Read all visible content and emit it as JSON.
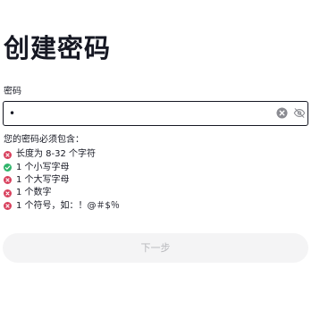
{
  "title": "创建密码",
  "password_field": {
    "label": "密码",
    "value": "•",
    "clear_icon": "clear-circle-x-icon",
    "toggle_icon": "eye-slash-icon"
  },
  "requirements": {
    "heading": "您的密码必须包含：",
    "items": [
      {
        "text": "长度为 8-32 个字符",
        "met": false,
        "icon": "x-circle-icon"
      },
      {
        "text": "1 个小写字母",
        "met": true,
        "icon": "check-circle-icon"
      },
      {
        "text": "1 个大写字母",
        "met": false,
        "icon": "x-circle-icon"
      },
      {
        "text": "1 个数字",
        "met": false,
        "icon": "x-circle-icon"
      },
      {
        "text": "1 个符号，如：！@＃$％",
        "met": false,
        "icon": "x-circle-icon"
      }
    ]
  },
  "next_button": {
    "label": "下一步",
    "enabled": false
  },
  "colors": {
    "unmet": "#d8405d",
    "met": "#2fb56b",
    "text": "#161823",
    "button_bg": "#f4f4f5",
    "button_text": "#b7b8bc"
  }
}
